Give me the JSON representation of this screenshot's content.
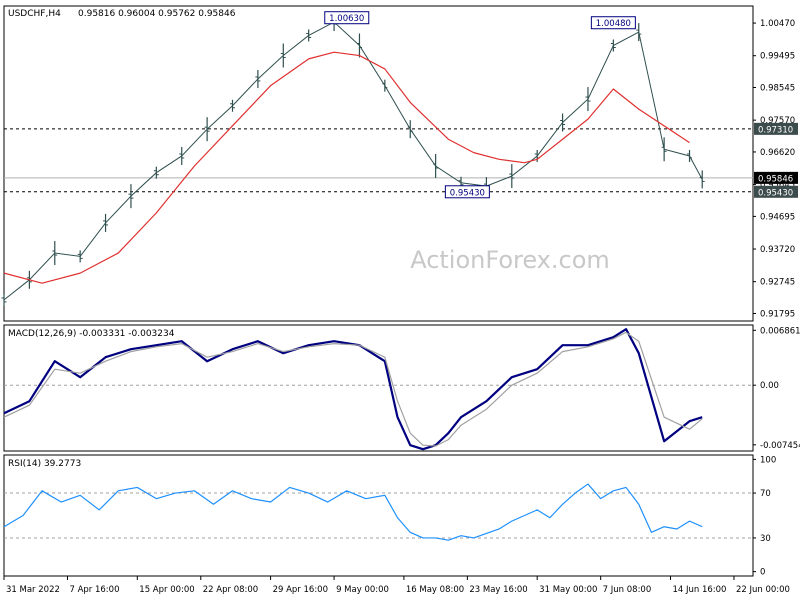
{
  "chart_data": [
    {
      "type": "line",
      "panel": "price",
      "header": {
        "symbol": "USDCHF,H4",
        "ohlc": "0.95816 0.96004 0.95762 0.95846"
      },
      "watermark": "ActionForex.com",
      "ylim": [
        0.916,
        1.0095
      ],
      "y_ticks": [
        {
          "label": "1.00470",
          "value": 1.0047
        },
        {
          "label": "0.99495",
          "value": 0.99495
        },
        {
          "label": "0.98545",
          "value": 0.98545
        },
        {
          "label": "0.97570",
          "value": 0.9757
        },
        {
          "label": "0.96620",
          "value": 0.9662
        },
        {
          "label": "0.95645",
          "value": 0.95645
        },
        {
          "label": "0.94695",
          "value": 0.94695
        },
        {
          "label": "0.93720",
          "value": 0.9372
        },
        {
          "label": "0.92745",
          "value": 0.92745
        },
        {
          "label": "0.91795",
          "value": 0.91795
        }
      ],
      "horizontal_lines": [
        {
          "label": "0.97310",
          "value": 0.9731,
          "style": "dashed"
        },
        {
          "label": "0.95430",
          "value": 0.9543,
          "style": "dashed"
        },
        {
          "label": "0.95846",
          "value": 0.95846,
          "style": "current-price"
        }
      ],
      "annotations": [
        {
          "label": "1.00630",
          "x": 54,
          "y": 1.0063
        },
        {
          "label": "1.00480",
          "x": 96,
          "y": 1.0048
        },
        {
          "label": "0.95430",
          "x": 73,
          "y": 0.9543
        }
      ],
      "series": [
        {
          "role": "price",
          "style": "bars",
          "color": "#2f4f4f",
          "x": [
            0,
            4,
            8,
            12,
            16,
            20,
            24,
            28,
            32,
            36,
            40,
            44,
            48,
            52,
            56,
            60,
            64,
            68,
            72,
            76,
            80,
            84,
            88,
            92,
            96,
            100,
            104,
            108,
            110
          ],
          "values": [
            0.922,
            0.928,
            0.936,
            0.935,
            0.945,
            0.953,
            0.96,
            0.965,
            0.973,
            0.98,
            0.988,
            0.995,
            1.001,
            1.005,
            0.998,
            0.986,
            0.973,
            0.962,
            0.957,
            0.956,
            0.959,
            0.965,
            0.975,
            0.982,
            0.998,
            1.002,
            0.967,
            0.965,
            0.958
          ]
        },
        {
          "role": "moving-average",
          "color": "#e03030",
          "x": [
            0,
            6,
            12,
            18,
            24,
            30,
            36,
            42,
            48,
            52,
            56,
            60,
            64,
            70,
            74,
            78,
            82,
            84,
            88,
            92,
            96,
            100,
            104,
            108
          ],
          "values": [
            0.93,
            0.927,
            0.93,
            0.936,
            0.948,
            0.962,
            0.974,
            0.986,
            0.994,
            0.996,
            0.995,
            0.991,
            0.981,
            0.97,
            0.966,
            0.964,
            0.963,
            0.964,
            0.97,
            0.976,
            0.985,
            0.979,
            0.974,
            0.969
          ]
        }
      ]
    },
    {
      "type": "line",
      "panel": "macd",
      "header": "MACD(12,26,9) -0.003331 -0.003234",
      "ylim": [
        -0.0081,
        0.0074
      ],
      "y_ticks": [
        {
          "label": "0.006861",
          "value": 0.006861
        },
        {
          "label": "0.00",
          "value": 0.0
        },
        {
          "label": "-0.007454",
          "value": -0.007454
        }
      ],
      "horizontal_lines": [
        {
          "value": 0.0,
          "style": "dashed"
        }
      ],
      "series": [
        {
          "role": "macd",
          "color": "#000080",
          "x": [
            0,
            4,
            8,
            12,
            16,
            20,
            24,
            28,
            32,
            36,
            40,
            44,
            48,
            52,
            56,
            60,
            62,
            64,
            66,
            68,
            70,
            72,
            76,
            80,
            84,
            88,
            92,
            96,
            98,
            100,
            104,
            108,
            110
          ],
          "values": [
            -0.0035,
            -0.002,
            0.003,
            0.001,
            0.0035,
            0.0045,
            0.005,
            0.0055,
            0.003,
            0.0045,
            0.0055,
            0.004,
            0.005,
            0.0055,
            0.005,
            0.003,
            -0.004,
            -0.0075,
            -0.008,
            -0.0075,
            -0.006,
            -0.004,
            -0.002,
            0.001,
            0.002,
            0.005,
            0.005,
            0.006,
            0.007,
            0.004,
            -0.007,
            -0.0045,
            -0.004
          ]
        },
        {
          "role": "signal",
          "color": "#a0a0a0",
          "x": [
            0,
            4,
            8,
            12,
            16,
            20,
            24,
            28,
            32,
            36,
            40,
            44,
            48,
            52,
            56,
            60,
            62,
            64,
            66,
            68,
            70,
            72,
            76,
            80,
            84,
            88,
            92,
            96,
            98,
            100,
            104,
            108,
            110
          ],
          "values": [
            -0.004,
            -0.0025,
            0.002,
            0.0015,
            0.003,
            0.0042,
            0.0048,
            0.0052,
            0.0035,
            0.0042,
            0.0052,
            0.0042,
            0.0048,
            0.0052,
            0.005,
            0.0035,
            -0.002,
            -0.006,
            -0.0075,
            -0.0076,
            -0.0068,
            -0.005,
            -0.003,
            0.0,
            0.0015,
            0.0042,
            0.0048,
            0.0058,
            0.0066,
            0.0055,
            -0.004,
            -0.0055,
            -0.0042
          ]
        }
      ]
    },
    {
      "type": "line",
      "panel": "rsi",
      "header": "RSI(14) 39.2773",
      "ylim": [
        -3,
        103
      ],
      "y_ticks": [
        {
          "label": "100",
          "value": 100
        },
        {
          "label": "70",
          "value": 70
        },
        {
          "label": "30",
          "value": 30
        },
        {
          "label": "0",
          "value": 0
        }
      ],
      "horizontal_lines": [
        {
          "value": 70,
          "style": "dashed"
        },
        {
          "value": 30,
          "style": "dashed"
        }
      ],
      "series": [
        {
          "role": "rsi",
          "color": "#1e90ff",
          "x": [
            0,
            3,
            6,
            9,
            12,
            15,
            18,
            21,
            24,
            27,
            30,
            33,
            36,
            39,
            42,
            45,
            48,
            51,
            54,
            57,
            60,
            62,
            64,
            66,
            68,
            70,
            72,
            74,
            76,
            78,
            80,
            82,
            84,
            86,
            88,
            90,
            92,
            94,
            96,
            98,
            100,
            102,
            104,
            106,
            108,
            110
          ],
          "values": [
            40,
            50,
            72,
            62,
            68,
            55,
            72,
            75,
            65,
            70,
            72,
            60,
            72,
            65,
            62,
            75,
            70,
            62,
            72,
            65,
            68,
            48,
            35,
            30,
            30,
            28,
            32,
            30,
            34,
            38,
            45,
            50,
            55,
            48,
            60,
            70,
            78,
            65,
            72,
            75,
            60,
            35,
            40,
            38,
            45,
            40
          ]
        }
      ]
    },
    {
      "type": "axis",
      "panel": "time-axis",
      "x_ticks": [
        {
          "label": "31 Mar 2022",
          "x": 0
        },
        {
          "label": "7 Apr 16:00",
          "x": 10
        },
        {
          "label": "15 Apr 00:00",
          "x": 21
        },
        {
          "label": "22 Apr 08:00",
          "x": 31
        },
        {
          "label": "29 Apr 16:00",
          "x": 42
        },
        {
          "label": "9 May 00:00",
          "x": 52
        },
        {
          "label": "16 May 08:00",
          "x": 63
        },
        {
          "label": "23 May 16:00",
          "x": 73
        },
        {
          "label": "31 May 00:00",
          "x": 84
        },
        {
          "label": "7 Jun 08:00",
          "x": 94
        },
        {
          "label": "14 Jun 16:00",
          "x": 105
        },
        {
          "label": "22 Jun 00:00",
          "x": 115
        }
      ]
    }
  ]
}
